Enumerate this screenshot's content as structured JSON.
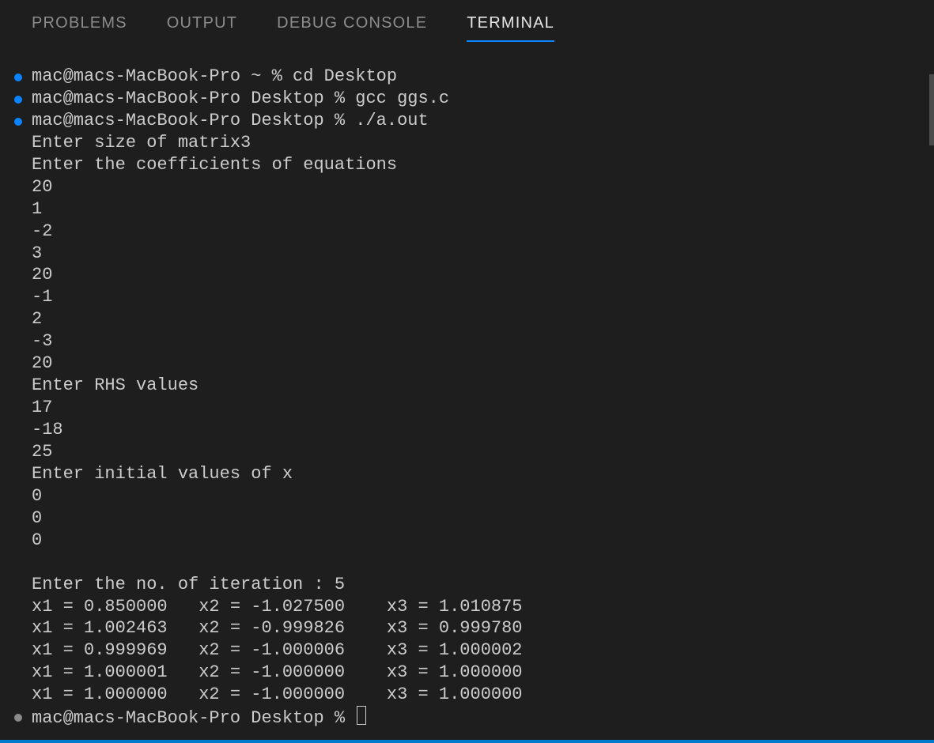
{
  "tabs": {
    "problems": "PROBLEMS",
    "output": "OUTPUT",
    "debug_console": "DEBUG CONSOLE",
    "terminal": "TERMINAL"
  },
  "terminal": {
    "lines": [
      {
        "bullet": "blue",
        "text": "mac@macs-MacBook-Pro ~ % cd Desktop"
      },
      {
        "bullet": "blue",
        "text": "mac@macs-MacBook-Pro Desktop % gcc ggs.c"
      },
      {
        "bullet": "blue",
        "text": "mac@macs-MacBook-Pro Desktop % ./a.out"
      },
      {
        "bullet": "",
        "text": "Enter size of matrix3"
      },
      {
        "bullet": "",
        "text": "Enter the coefficients of equations"
      },
      {
        "bullet": "",
        "text": "20"
      },
      {
        "bullet": "",
        "text": "1"
      },
      {
        "bullet": "",
        "text": "-2"
      },
      {
        "bullet": "",
        "text": "3"
      },
      {
        "bullet": "",
        "text": "20"
      },
      {
        "bullet": "",
        "text": "-1"
      },
      {
        "bullet": "",
        "text": "2"
      },
      {
        "bullet": "",
        "text": "-3"
      },
      {
        "bullet": "",
        "text": "20"
      },
      {
        "bullet": "",
        "text": "Enter RHS values"
      },
      {
        "bullet": "",
        "text": "17"
      },
      {
        "bullet": "",
        "text": "-18"
      },
      {
        "bullet": "",
        "text": "25"
      },
      {
        "bullet": "",
        "text": "Enter initial values of x"
      },
      {
        "bullet": "",
        "text": "0"
      },
      {
        "bullet": "",
        "text": "0"
      },
      {
        "bullet": "",
        "text": "0"
      },
      {
        "bullet": "",
        "text": ""
      },
      {
        "bullet": "",
        "text": "Enter the no. of iteration : 5"
      },
      {
        "bullet": "",
        "text": "x1 = 0.850000   x2 = -1.027500    x3 = 1.010875"
      },
      {
        "bullet": "",
        "text": "x1 = 1.002463   x2 = -0.999826    x3 = 0.999780"
      },
      {
        "bullet": "",
        "text": "x1 = 0.999969   x2 = -1.000006    x3 = 1.000002"
      },
      {
        "bullet": "",
        "text": "x1 = 1.000001   x2 = -1.000000    x3 = 1.000000"
      },
      {
        "bullet": "",
        "text": "x1 = 1.000000   x2 = -1.000000    x3 = 1.000000"
      }
    ],
    "final_prompt": "mac@macs-MacBook-Pro Desktop % "
  }
}
